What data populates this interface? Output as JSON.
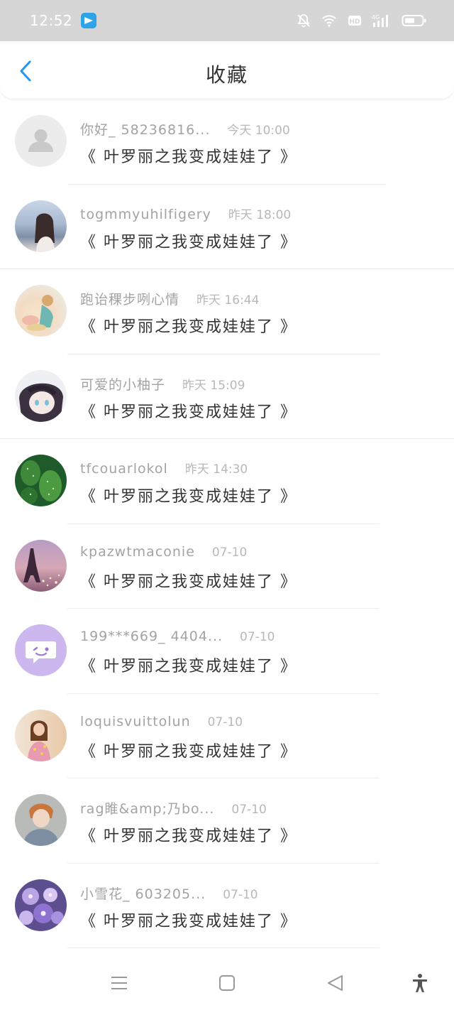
{
  "status_bar": {
    "time": "12:52",
    "network_label": "4G",
    "icons": [
      "app-notification-icon",
      "silent-bell-icon",
      "wifi-icon",
      "hd-icon",
      "signal-icon",
      "battery-icon"
    ]
  },
  "nav": {
    "title": "收藏",
    "back_icon": "chevron-left-icon",
    "accent_color": "#2196f3"
  },
  "items": [
    {
      "name": "你好_ 58236816...",
      "time": "今天 10:00",
      "book": "《 叶罗丽之我变成娃娃了 》",
      "avatar": "default-avatar"
    },
    {
      "name": "togmmyuhilfigery",
      "time": "昨天 18:00",
      "book": "《 叶罗丽之我变成娃娃了 》",
      "avatar": "girl-seaside-photo"
    },
    {
      "name": "跑诒稞步咧心情",
      "time": "昨天 16:44",
      "book": "《 叶罗丽之我变成娃娃了 》",
      "avatar": "illustration-girl"
    },
    {
      "name": "可爱的小柚子",
      "time": "昨天 15:09",
      "book": "《 叶罗丽之我变成娃娃了 》",
      "avatar": "anime-girl"
    },
    {
      "name": "tfcouarlokol",
      "time": "昨天 14:30",
      "book": "《 叶罗丽之我变成娃娃了 》",
      "avatar": "cactus-photo"
    },
    {
      "name": "kpazwtmaconie",
      "time": "07-10",
      "book": "《 叶罗丽之我变成娃娃了 》",
      "avatar": "eiffel-tower-photo"
    },
    {
      "name": "199***669_ 4404...",
      "time": "07-10",
      "book": "《 叶罗丽之我变成娃娃了 》",
      "avatar": "chat-bubble-avatar"
    },
    {
      "name": "loquisvuittolun",
      "time": "07-10",
      "book": "《 叶罗丽之我变成娃娃了 》",
      "avatar": "girl-floral-dress"
    },
    {
      "name": "rag睢&amp;乃bo...",
      "time": "07-10",
      "book": "《 叶罗丽之我变成娃娃了 》",
      "avatar": "boy-portrait"
    },
    {
      "name": "小雪花_ 603205...",
      "time": "07-10",
      "book": "《 叶罗丽之我变成娃娃了 》",
      "avatar": "purple-flowers"
    }
  ],
  "bottom_nav": [
    "menu-icon",
    "home-square-icon",
    "back-triangle-icon",
    "accessibility-icon"
  ]
}
